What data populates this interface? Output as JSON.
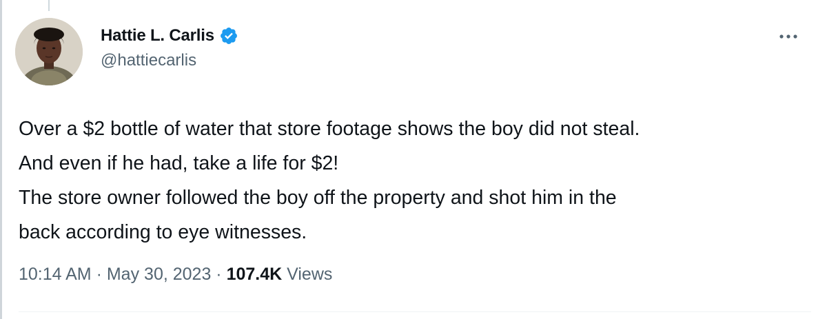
{
  "author": {
    "display_name": "Hattie L. Carlis",
    "handle": "@hattiecarlis",
    "verified": true
  },
  "icons": {
    "verified": "verified-badge-icon",
    "more": "more-options-icon"
  },
  "colors": {
    "verified_blue": "#1d9bf0",
    "text_primary": "#0f1419",
    "text_secondary": "#536471"
  },
  "tweet": {
    "lines": [
      "Over a $2 bottle of water that store footage shows the boy did not steal.",
      "And even if he had, take a life for $2!",
      "The store owner followed the boy off the property and shot him in the",
      "back according to eye witnesses."
    ]
  },
  "meta": {
    "time": "10:14 AM",
    "separator": " · ",
    "date": "May 30, 2023",
    "views_count": "107.4K",
    "views_label": "Views"
  }
}
